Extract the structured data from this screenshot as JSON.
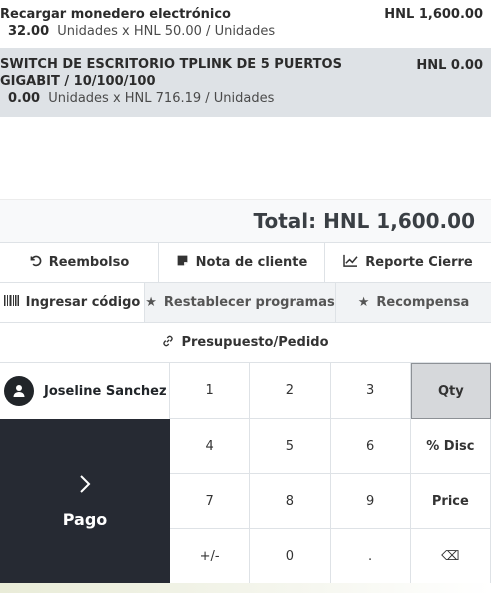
{
  "order": {
    "lines": [
      {
        "name": "Recargar monedero electrónico",
        "price": "HNL 1,600.00",
        "qty": "32.00",
        "detail": "Unidades x HNL 50.00 / Unidades"
      },
      {
        "name": "SWITCH DE ESCRITORIO TPLINK DE 5 PUERTOS GIGABIT / 10/100/100",
        "price": "HNL 0.00",
        "qty": "0.00",
        "detail": "Unidades x HNL 716.19 / Unidades"
      }
    ],
    "total_label": "Total: HNL 1,600.00"
  },
  "controls": {
    "refund": "Reembolso",
    "customer_note": "Nota de cliente",
    "closing_report": "Reporte Cierre",
    "enter_code": "Ingresar código",
    "reset_programs": "Restablecer programas",
    "reward": "Recompensa",
    "quotation": "Presupuesto/Pedido"
  },
  "customer": {
    "name": "Joseline Sanchez"
  },
  "payment": {
    "label": "Pago"
  },
  "numpad": {
    "k1": "1",
    "k2": "2",
    "k3": "3",
    "qty": "Qty",
    "k4": "4",
    "k5": "5",
    "k6": "6",
    "disc": "% Disc",
    "k7": "7",
    "k8": "8",
    "k9": "9",
    "price": "Price",
    "sign": "+/-",
    "k0": "0",
    "dot": ".",
    "backspace": "⌫"
  },
  "icons": {
    "refund": "undo-icon",
    "note": "note-icon",
    "report": "chart-line-icon",
    "barcode": "barcode-icon",
    "star": "star-icon",
    "link": "link-icon",
    "user": "user-icon",
    "chevron": "chevron-right-icon"
  },
  "colors": {
    "selected_line": "#dee2e6",
    "pay_bg": "#262a33",
    "active_mode": "#d6d8db"
  }
}
